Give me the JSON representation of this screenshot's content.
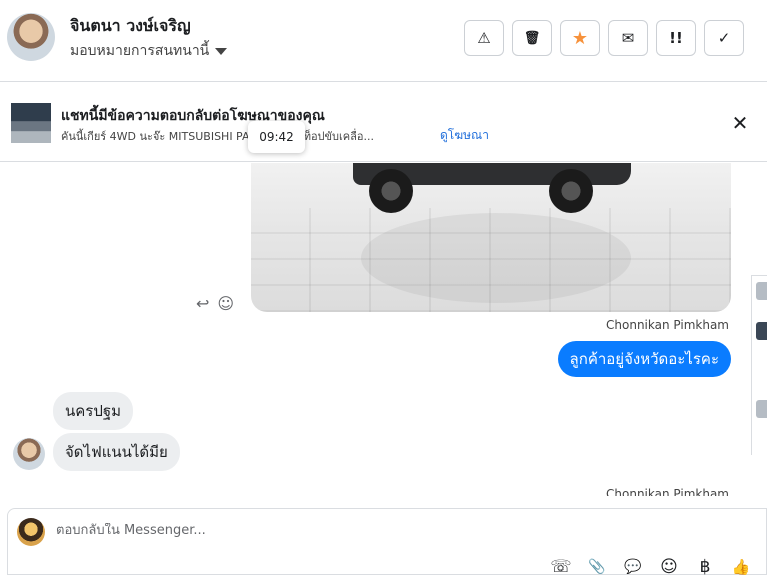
{
  "header": {
    "contact_name": "จินตนา วงษ์เจริญ",
    "assign_label": "มอบหมายการสนทนานี้",
    "actions": [
      {
        "icon": "warning-icon",
        "glyph": "⚠"
      },
      {
        "icon": "trash-icon",
        "glyph": "🗑"
      },
      {
        "icon": "star-icon",
        "glyph": "★",
        "color": "#f7923b"
      },
      {
        "icon": "mark-unread-icon",
        "glyph": "✉"
      },
      {
        "icon": "follow-up-icon",
        "glyph": "!!"
      },
      {
        "icon": "done-icon",
        "glyph": "✓"
      }
    ]
  },
  "ad_banner": {
    "title": "แชทนี้มีข้อความตอบกลับต่อโฆษณาของคุณ",
    "description": "คันนี้เกียร์ 4WD นะจ๊ะ MITSUBISHI PA",
    "description_tail": "T 2013 ตัวท็อปขับเคลื่อ...",
    "link": "ดูโฆษณา",
    "tooltip_time": "09:42"
  },
  "messages": {
    "sender_name": "Chonnikan Pimkham",
    "outgoing_1": "ลูกค้าอยู่จังหวัดอะไรคะ",
    "incoming_1": "นครปฐม",
    "incoming_2": "จัดไฟแนนได้มีย",
    "sender_name_2": "Chonnikan Pimkham"
  },
  "composer": {
    "placeholder": "ตอบกลับใน Messenger...",
    "tools": [
      {
        "icon": "add-call-icon",
        "glyph": "☏"
      },
      {
        "icon": "attachment-icon",
        "glyph": "📎"
      },
      {
        "icon": "saved-replies-icon",
        "glyph": "💬"
      },
      {
        "icon": "emoji-icon",
        "glyph": "☺"
      },
      {
        "icon": "payment-icon",
        "glyph": "฿"
      },
      {
        "icon": "like-icon",
        "glyph": "👍"
      }
    ]
  },
  "colors": {
    "accent": "#0a7cff",
    "link": "#216fdb",
    "star": "#f7923b"
  }
}
